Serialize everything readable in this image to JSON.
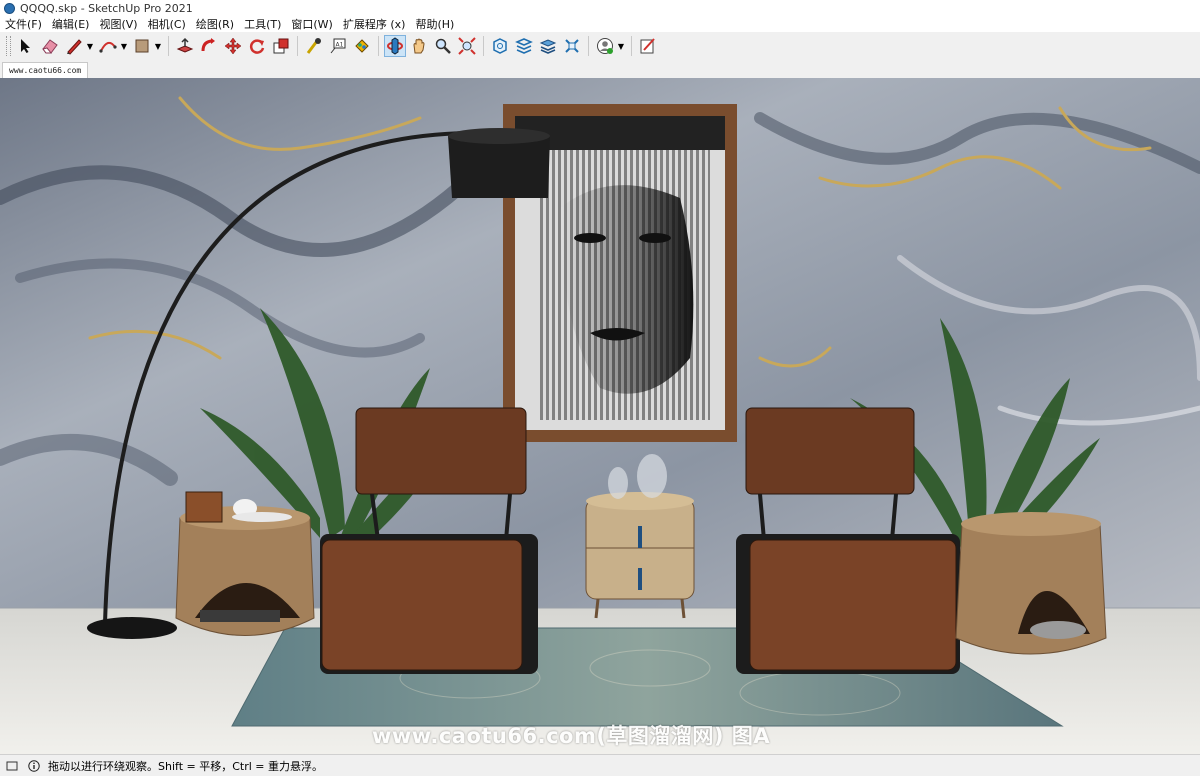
{
  "window": {
    "title": "QQQQ.skp - SketchUp Pro 2021",
    "icon": "sketchup-logo-icon"
  },
  "menu": [
    {
      "label": "文件(F)"
    },
    {
      "label": "编辑(E)"
    },
    {
      "label": "视图(V)"
    },
    {
      "label": "相机(C)"
    },
    {
      "label": "绘图(R)"
    },
    {
      "label": "工具(T)"
    },
    {
      "label": "窗口(W)"
    },
    {
      "label": "扩展程序 (x)"
    },
    {
      "label": "帮助(H)"
    }
  ],
  "toolbar": {
    "tools": [
      "select-icon",
      "eraser-icon",
      "pencil-line-icon",
      "arc-icon",
      "rectangle-shape-icon",
      "push-pull-icon",
      "follow-me-icon",
      "move-icon",
      "rotate-icon",
      "scale-icon",
      "tape-measure-icon",
      "text-icon",
      "paint-bucket-icon",
      "orbit-icon",
      "pan-icon",
      "zoom-icon",
      "zoom-extents-icon",
      "3d-warehouse-icon",
      "extension-warehouse-icon",
      "layout-icon",
      "extension-manager-icon",
      "profile-icon",
      "style-builder-icon"
    ],
    "active_tool": "orbit-icon"
  },
  "tab": {
    "label": "www.caotu66.com"
  },
  "scene": {
    "wall": "marble-wall",
    "artwork": "framed-face-portrait",
    "objects": [
      "arc-floor-lamp",
      "palm-plant",
      "palm-plant",
      "lounge-chair",
      "lounge-chair",
      "wooden-side-table",
      "rattan-bedside-cabinet",
      "wooden-side-table",
      "area-rug"
    ],
    "colors": {
      "chair": "#6b3a22",
      "wood": "#a3805a",
      "lamp": "#1d1d1d",
      "rug": "#6f8d93"
    }
  },
  "watermark": "www.caotu66.com(草图溜溜网) 图A",
  "status": {
    "text": "拖动以进行环绕观察。Shift = 平移，Ctrl = 重力悬浮。"
  }
}
